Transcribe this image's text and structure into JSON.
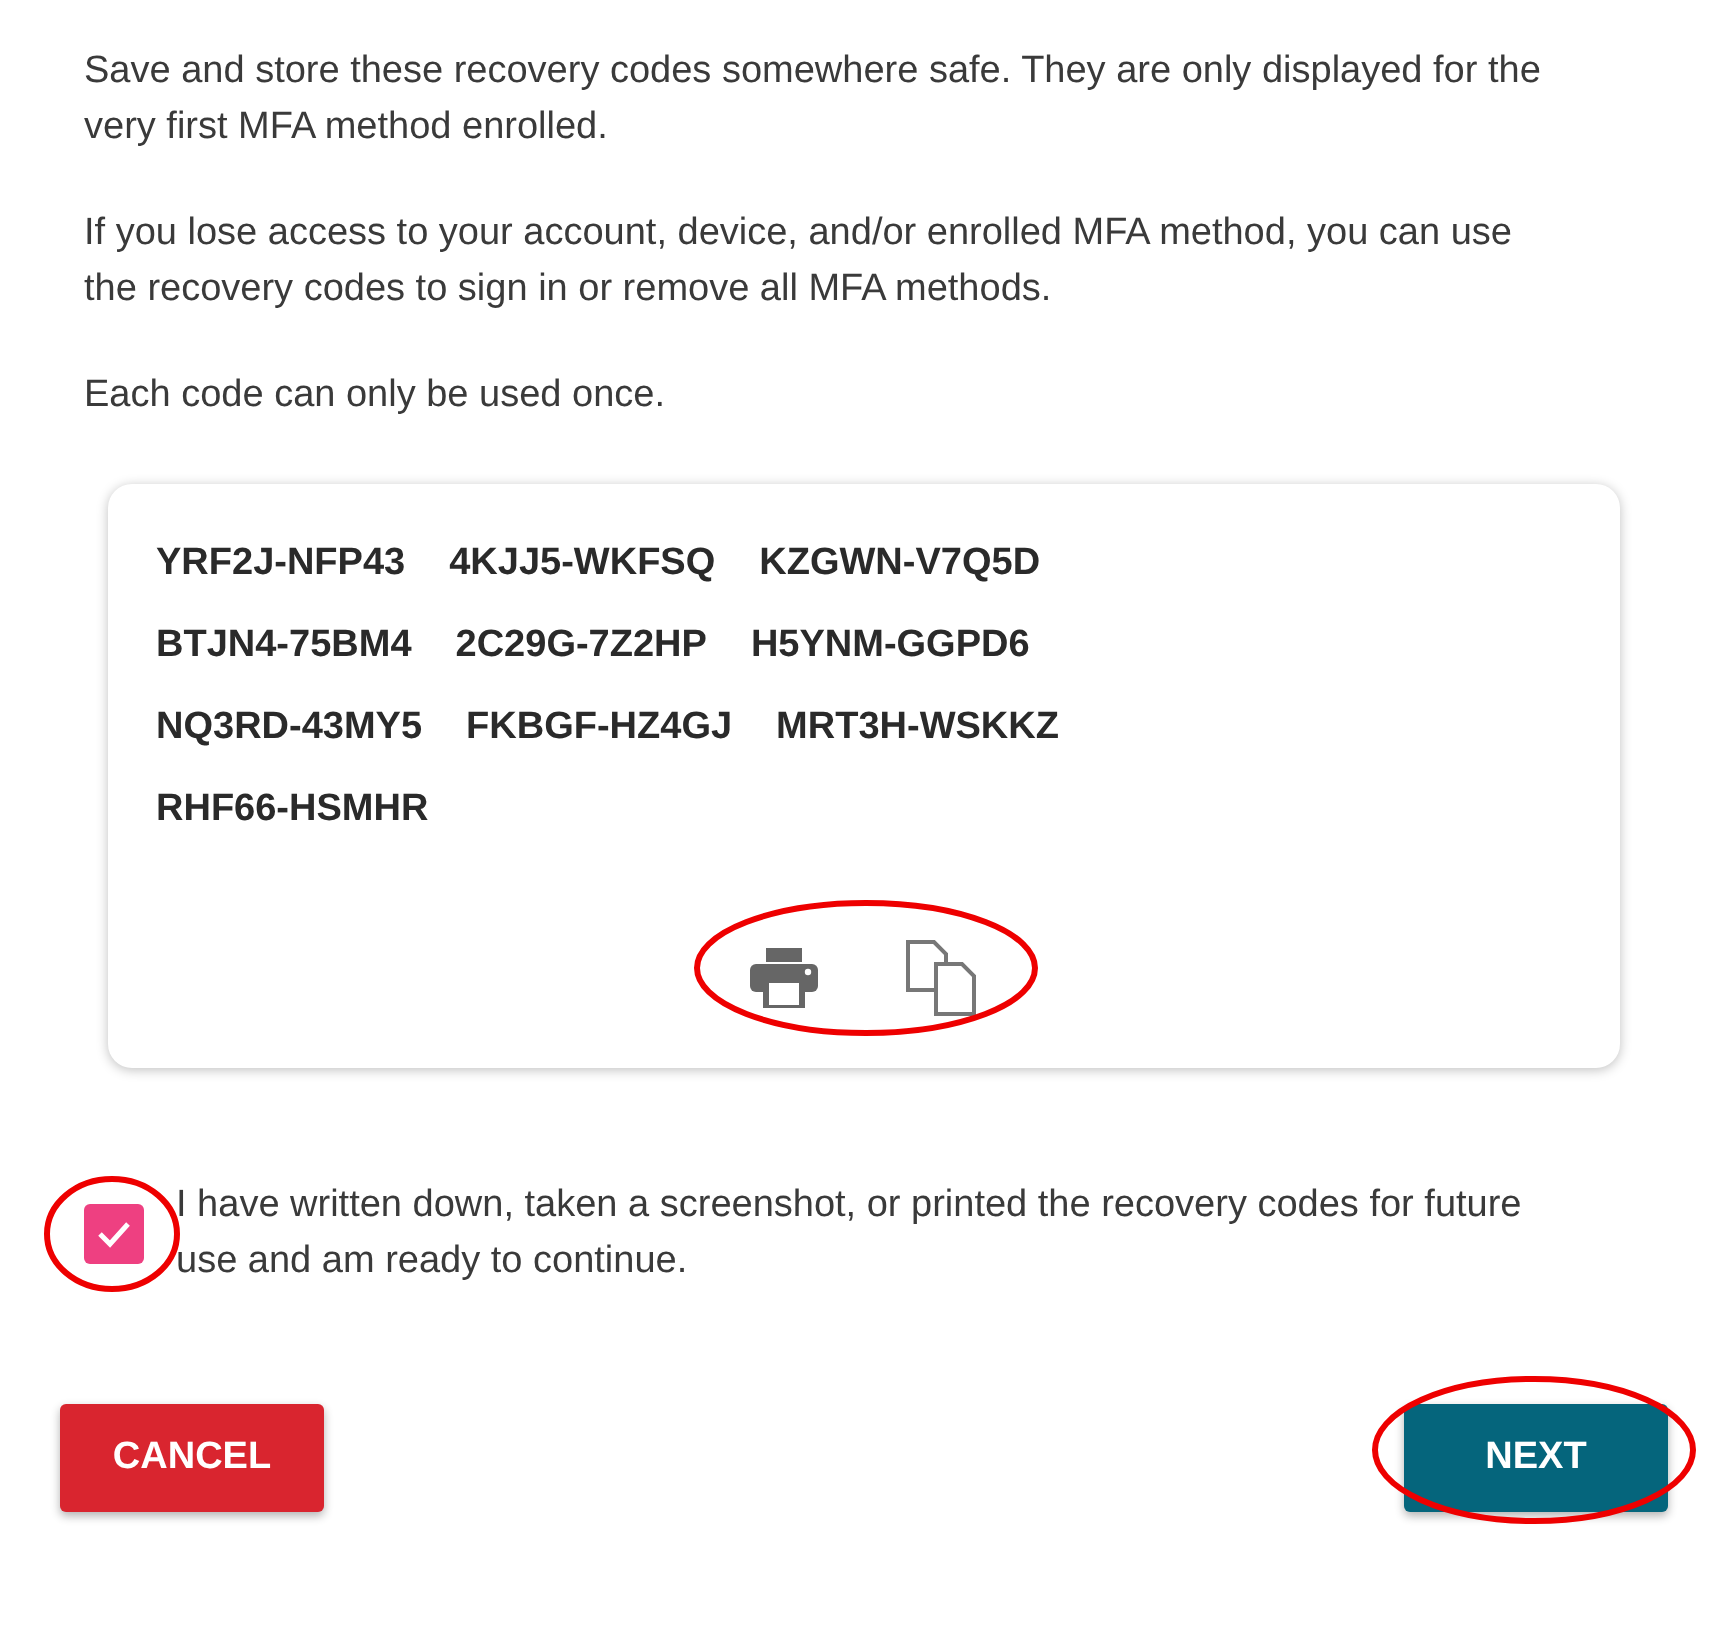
{
  "paragraphs": [
    "Save and store these recovery codes somewhere safe. They are only displayed for the very first MFA method enrolled.",
    "If you lose access to your account, device, and/or enrolled MFA method, you can use the recovery codes to sign in or remove all MFA methods.",
    "Each code can only be used once."
  ],
  "codes": [
    "YRF2J-NFP43",
    "4KJJ5-WKFSQ",
    "KZGWN-V7Q5D",
    "BTJN4-75BM4",
    "2C29G-7Z2HP",
    "H5YNM-GGPD6",
    "NQ3RD-43MY5",
    "FKBGF-HZ4GJ",
    "MRT3H-WSKKZ",
    "RHF66-HSMHR"
  ],
  "confirm": {
    "checked": true,
    "label": "I have written down, taken a screenshot, or printed the recovery codes for future use and am ready to continue."
  },
  "buttons": {
    "cancel": "CANCEL",
    "next": "NEXT"
  }
}
